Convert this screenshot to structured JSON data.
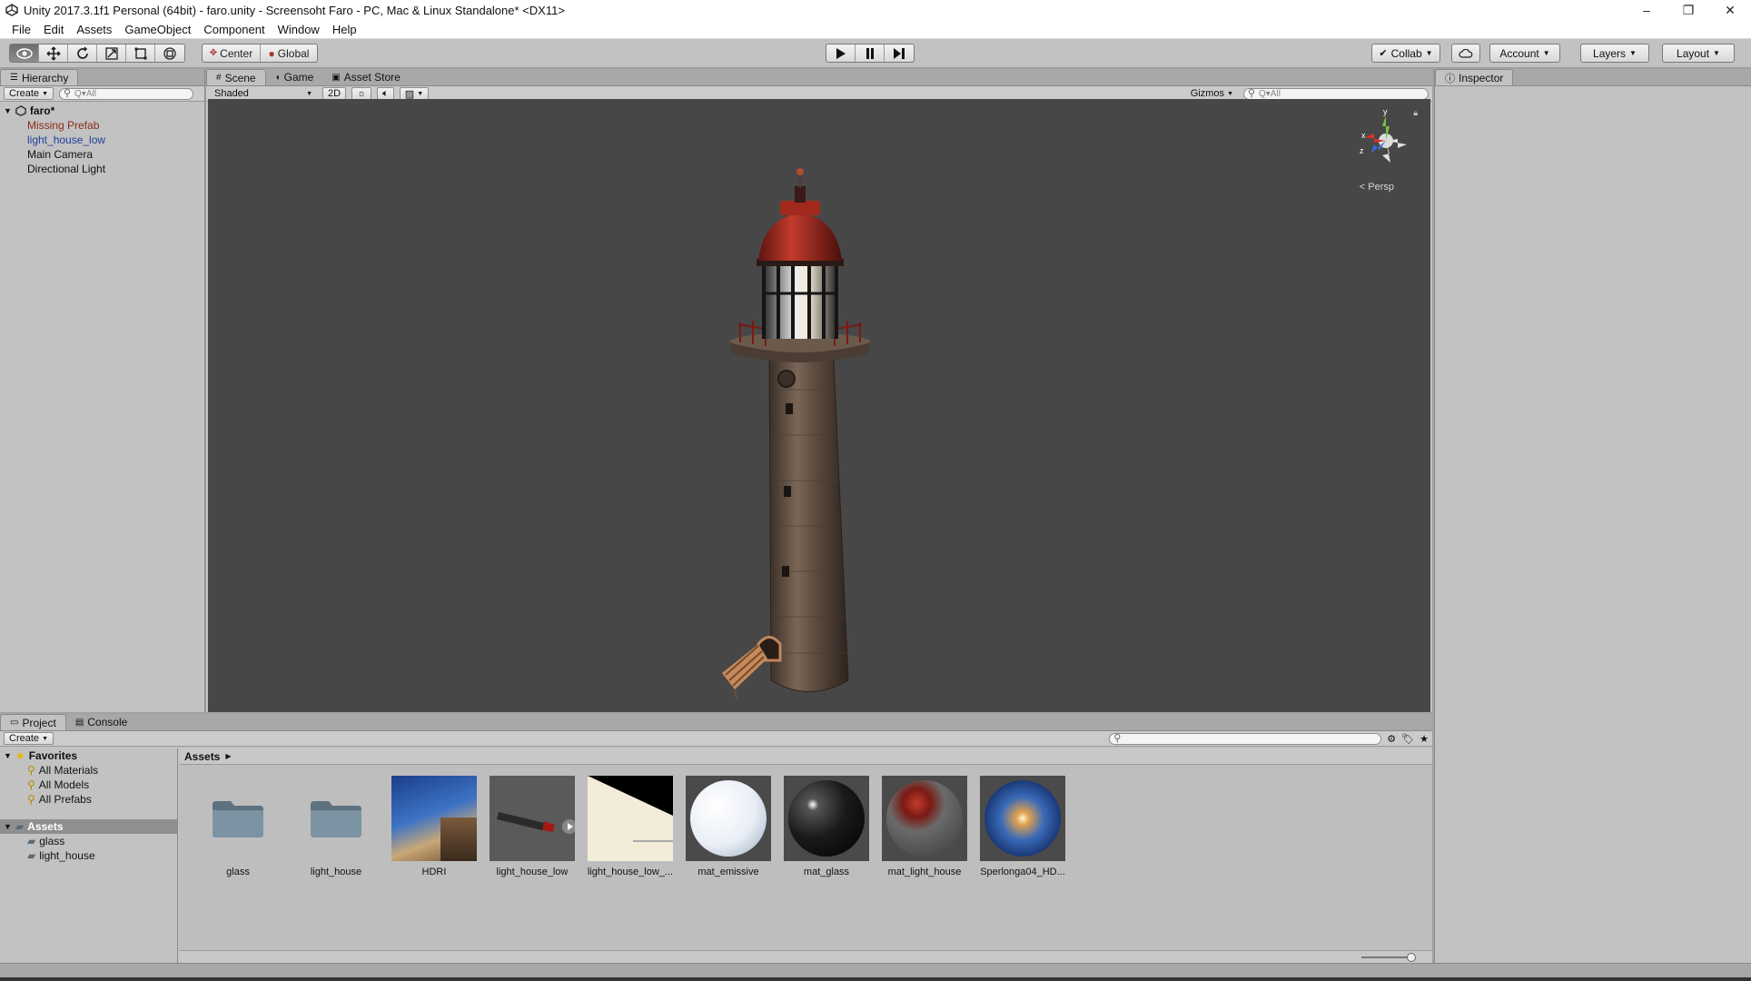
{
  "window": {
    "title": "Unity 2017.3.1f1 Personal (64bit) - faro.unity - Screensoht Faro - PC, Mac & Linux Standalone* <DX11>",
    "controls": [
      "–",
      "❐",
      "✕"
    ]
  },
  "menu": [
    "File",
    "Edit",
    "Assets",
    "GameObject",
    "Component",
    "Window",
    "Help"
  ],
  "toolbar": {
    "pivot_label": "Center",
    "space_label": "Global",
    "collab_label": "Collab",
    "account_label": "Account",
    "layers_label": "Layers",
    "layout_label": "Layout"
  },
  "hierarchy": {
    "tab_label": "Hierarchy",
    "create_label": "Create",
    "search_placeholder": "Q▾All",
    "scene_name": "faro*",
    "items": [
      {
        "label": "Missing Prefab",
        "color": "#8a2b1a"
      },
      {
        "label": "light_house_low",
        "color": "#1d3f9c"
      },
      {
        "label": "Main Camera",
        "color": "#111111"
      },
      {
        "label": "Directional Light",
        "color": "#111111"
      }
    ]
  },
  "scene": {
    "tabs": [
      "Scene",
      "Game",
      "Asset Store"
    ],
    "shading_mode": "Shaded",
    "mode_2d": "2D",
    "gizmos_label": "Gizmos",
    "search_placeholder": "Q▾All",
    "projection_label": "Persp",
    "gizmo_axes": {
      "x": "x",
      "y": "y",
      "z": "z"
    }
  },
  "inspector": {
    "tab_label": "Inspector"
  },
  "project": {
    "tabs": [
      "Project",
      "Console"
    ],
    "create_label": "Create",
    "favorites_label": "Favorites",
    "favorites": [
      "All Materials",
      "All Models",
      "All Prefabs"
    ],
    "assets_label": "Assets",
    "folders": [
      "glass",
      "light_house"
    ],
    "breadcrumb": "Assets",
    "assets": [
      {
        "label": "glass",
        "icon": "folder-icon"
      },
      {
        "label": "light_house",
        "icon": "folder-icon"
      },
      {
        "label": "HDRI",
        "icon": "hdri-texture-thumbnail"
      },
      {
        "label": "light_house_low",
        "icon": "model-prefab-thumbnail"
      },
      {
        "label": "light_house_low_...",
        "icon": "texture-thumbnail"
      },
      {
        "label": "mat_emissive",
        "icon": "material-sphere-thumbnail"
      },
      {
        "label": "mat_glass",
        "icon": "material-sphere-thumbnail"
      },
      {
        "label": "mat_light_house",
        "icon": "material-sphere-thumbnail"
      },
      {
        "label": "Sperlonga04_HD...",
        "icon": "skybox-sphere-thumbnail"
      }
    ]
  }
}
